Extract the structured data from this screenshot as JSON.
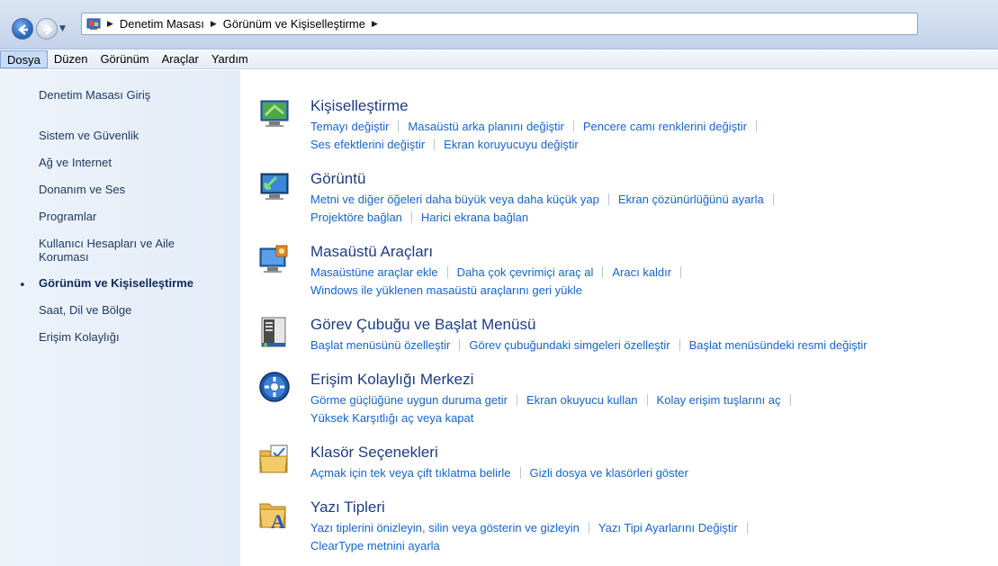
{
  "address": {
    "crumbs": [
      "Denetim Masası",
      "Görünüm ve Kişiselleştirme"
    ]
  },
  "menu": {
    "items": [
      "Dosya",
      "Düzen",
      "Görünüm",
      "Araçlar",
      "Yardım"
    ],
    "active": "Dosya"
  },
  "sidebar": {
    "items": [
      "Denetim Masası Giriş",
      "Sistem ve Güvenlik",
      "Ağ ve Internet",
      "Donanım ve Ses",
      "Programlar",
      "Kullanıcı Hesapları ve Aile",
      "Koruması",
      "Görünüm ve Kişiselleştirme",
      "Saat, Dil ve Bölge",
      "Erişim Kolaylığı"
    ],
    "bullet": "•"
  },
  "categories": [
    {
      "title": "Kişiselleştirme",
      "icon": "personalization-icon",
      "rows": [
        [
          "Temayı değiştir",
          "Masaüstü arka planını değiştir",
          "Pencere camı renklerini değiştir"
        ],
        [
          "Ses efektlerini değiştir",
          "Ekran koruyucuyu değiştir"
        ]
      ]
    },
    {
      "title": "Görüntü",
      "icon": "display-icon",
      "rows": [
        [
          "Metni ve diğer öğeleri daha büyük veya daha küçük yap",
          "Ekran çözünürlüğünü ayarla"
        ],
        [
          "Projektöre bağlan",
          "Harici ekrana bağlan"
        ]
      ]
    },
    {
      "title": "Masaüstü Araçları",
      "icon": "desktop-gadgets-icon",
      "rows": [
        [
          "Masaüstüne araçlar ekle",
          "Daha çok çevrimiçi araç al",
          "Aracı kaldır"
        ],
        [
          "Windows ile yüklenen masaüstü araçlarını geri yükle"
        ]
      ]
    },
    {
      "title": "Görev Çubuğu ve Başlat Menüsü",
      "icon": "taskbar-icon",
      "rows": [
        [
          "Başlat menüsünü özelleştir",
          "Görev çubuğundaki simgeleri özelleştir",
          "Başlat menüsündeki resmi değiştir"
        ]
      ]
    },
    {
      "title": "Erişim Kolaylığı Merkezi",
      "icon": "ease-of-access-icon",
      "rows": [
        [
          "Görme güçlüğüne uygun duruma getir",
          "Ekran okuyucu kullan",
          "Kolay erişim tuşlarını aç"
        ],
        [
          "Yüksek Karşıtlığı aç veya kapat"
        ]
      ]
    },
    {
      "title": "Klasör Seçenekleri",
      "icon": "folder-options-icon",
      "rows": [
        [
          "Açmak için tek veya çift tıklatma belirle",
          "Gizli dosya ve klasörleri göster"
        ]
      ]
    },
    {
      "title": "Yazı Tipleri",
      "icon": "fonts-icon",
      "rows": [
        [
          "Yazı tiplerini önizleyin, silin veya gösterin ve gizleyin",
          "Yazı Tipi Ayarlarını Değiştir"
        ],
        [
          "ClearType metnini ayarla"
        ]
      ]
    }
  ],
  "colors": {
    "link": "#1565c8",
    "title": "#1e3c82",
    "sidebar_text": "#1e3a64"
  }
}
